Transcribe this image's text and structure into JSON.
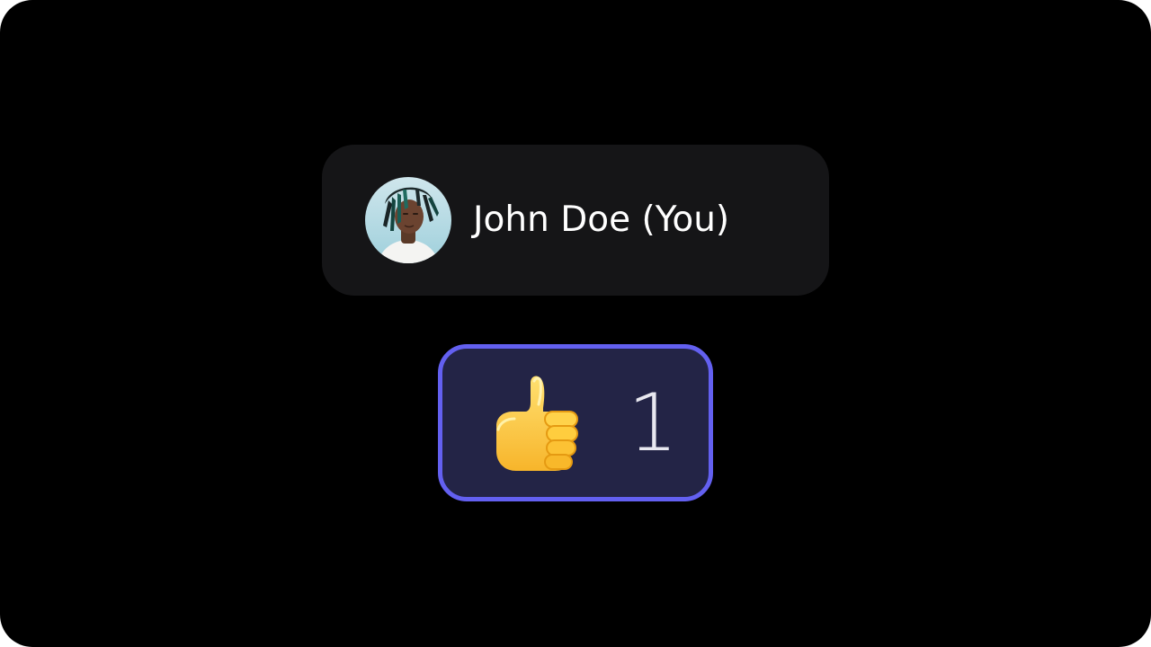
{
  "participant": {
    "name": "John Doe (You)",
    "avatar_icon": "user-avatar-photo"
  },
  "reaction": {
    "emoji_icon": "thumbs-up-icon",
    "count": "1",
    "selected": true,
    "accent_color": "#6360f0",
    "background_color": "#232446"
  },
  "theme": {
    "background": "#000000",
    "card_background": "#151517",
    "text_color": "#ffffff"
  }
}
